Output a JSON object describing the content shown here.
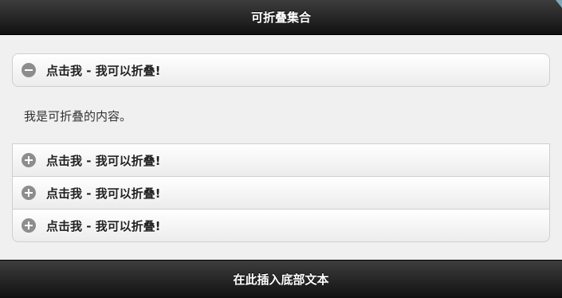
{
  "header": {
    "title": "可折叠集合"
  },
  "collapsibles": [
    {
      "label": "点击我 - 我可以折叠!",
      "state": "expanded",
      "icon": "minus-icon",
      "content": "我是可折叠的内容。"
    },
    {
      "label": "点击我 - 我可以折叠!",
      "state": "collapsed",
      "icon": "plus-icon"
    },
    {
      "label": "点击我 - 我可以折叠!",
      "state": "collapsed",
      "icon": "plus-icon"
    },
    {
      "label": "点击我 - 我可以折叠!",
      "state": "collapsed",
      "icon": "plus-icon"
    }
  ],
  "footer": {
    "text": "在此插入底部文本"
  }
}
